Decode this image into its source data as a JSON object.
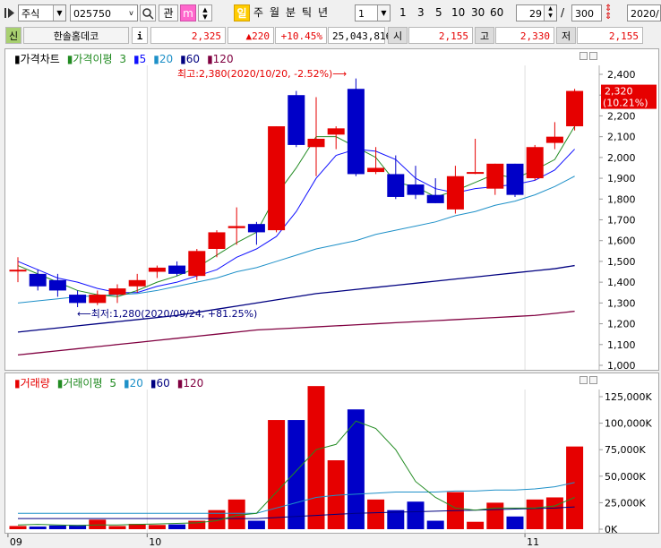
{
  "toolbar": {
    "market": "주식",
    "code": "025750",
    "fav_label": "관",
    "m_label": "m",
    "period_tabs": [
      "일",
      "주",
      "월",
      "분",
      "틱",
      "년"
    ],
    "interval_value": "1",
    "quick_intervals": [
      "1",
      "3",
      "5",
      "10",
      "30",
      "60"
    ],
    "count_value": "29",
    "slash": "/",
    "total_value": "300",
    "date_value": "2020/"
  },
  "info_bar": {
    "market_flag": "신",
    "name": "한솔홈데코",
    "info_button": "i",
    "price": "2,325",
    "change": "▲220",
    "change_pct": "+10.45%",
    "volume": "25,043,816",
    "open_label": "시",
    "open": "2,155",
    "high_label": "고",
    "high": "2,330",
    "low_label": "저",
    "low": "2,155"
  },
  "price_panel": {
    "legend": {
      "price": "가격차트",
      "ma_name": "가격이평",
      "ma3": "3",
      "ma5": "5",
      "ma20": "20",
      "ma60": "60",
      "ma120": "120"
    },
    "high_note": "최고:2,380(2020/10/20, -2.52%)⟶",
    "low_note": "⟵최저:1,280(2020/09/24, +81.25%)",
    "last_price": "2,320",
    "last_pct": "(10.21%)",
    "yticks": [
      "2,400",
      "2,300",
      "2,200",
      "2,100",
      "2,000",
      "1,900",
      "1,800",
      "1,700",
      "1,600",
      "1,500",
      "1,400",
      "1,300",
      "1,200",
      "1,100",
      "1,000"
    ]
  },
  "volume_panel": {
    "legend": {
      "vol": "거래량",
      "ma_name": "거래이평",
      "ma5": "5",
      "ma20": "20",
      "ma60": "60",
      "ma120": "120"
    },
    "yticks": [
      "125,000K",
      "100,000K",
      "75,000K",
      "50,000K",
      "25,000K",
      "0K"
    ]
  },
  "xticks": [
    "09",
    "10",
    "11"
  ],
  "colors": {
    "up": "#e60000",
    "down": "#0000c8",
    "ma3": "#228b22",
    "ma5": "#1010ff",
    "ma20": "#1e90c8",
    "ma60": "#000080",
    "ma120": "#800040"
  },
  "chart_data": {
    "type": "candlestick",
    "ylim": [
      1000,
      2400
    ],
    "vol_ylim": [
      0,
      125000
    ],
    "x_ticks": [
      {
        "label": "09",
        "index": 0
      },
      {
        "label": "10",
        "index": 7
      },
      {
        "label": "11",
        "index": 26
      }
    ],
    "candles": [
      {
        "o": 1460,
        "h": 1520,
        "l": 1400,
        "c": 1460,
        "v": 3000
      },
      {
        "o": 1440,
        "h": 1460,
        "l": 1360,
        "c": 1380,
        "v": 2500
      },
      {
        "o": 1410,
        "h": 1440,
        "l": 1330,
        "c": 1360,
        "v": 3500
      },
      {
        "o": 1340,
        "h": 1360,
        "l": 1280,
        "c": 1300,
        "v": 4000
      },
      {
        "o": 1300,
        "h": 1360,
        "l": 1290,
        "c": 1340,
        "v": 9000
      },
      {
        "o": 1340,
        "h": 1390,
        "l": 1300,
        "c": 1370,
        "v": 3000
      },
      {
        "o": 1380,
        "h": 1440,
        "l": 1350,
        "c": 1410,
        "v": 5000
      },
      {
        "o": 1450,
        "h": 1480,
        "l": 1420,
        "c": 1470,
        "v": 4000
      },
      {
        "o": 1480,
        "h": 1500,
        "l": 1430,
        "c": 1440,
        "v": 4500
      },
      {
        "o": 1430,
        "h": 1560,
        "l": 1410,
        "c": 1550,
        "v": 8000
      },
      {
        "o": 1560,
        "h": 1650,
        "l": 1520,
        "c": 1640,
        "v": 18000
      },
      {
        "o": 1660,
        "h": 1760,
        "l": 1580,
        "c": 1670,
        "v": 28000
      },
      {
        "o": 1680,
        "h": 1690,
        "l": 1580,
        "c": 1640,
        "v": 8000
      },
      {
        "o": 1650,
        "h": 2150,
        "l": 1640,
        "c": 2150,
        "v": 103000
      },
      {
        "o": 2300,
        "h": 2320,
        "l": 2050,
        "c": 2060,
        "v": 103000
      },
      {
        "o": 2050,
        "h": 2290,
        "l": 1910,
        "c": 2090,
        "v": 135000
      },
      {
        "o": 2110,
        "h": 2150,
        "l": 2040,
        "c": 2140,
        "v": 65000
      },
      {
        "o": 2330,
        "h": 2380,
        "l": 1910,
        "c": 1920,
        "v": 113000
      },
      {
        "o": 1930,
        "h": 2050,
        "l": 1920,
        "c": 1950,
        "v": 28000
      },
      {
        "o": 1920,
        "h": 2010,
        "l": 1800,
        "c": 1810,
        "v": 18000
      },
      {
        "o": 1870,
        "h": 1960,
        "l": 1800,
        "c": 1820,
        "v": 26000
      },
      {
        "o": 1820,
        "h": 1900,
        "l": 1780,
        "c": 1780,
        "v": 8000
      },
      {
        "o": 1750,
        "h": 1960,
        "l": 1730,
        "c": 1910,
        "v": 35000
      },
      {
        "o": 1930,
        "h": 2090,
        "l": 1920,
        "c": 1930,
        "v": 7000
      },
      {
        "o": 1850,
        "h": 1970,
        "l": 1820,
        "c": 1970,
        "v": 25000
      },
      {
        "o": 1970,
        "h": 1970,
        "l": 1810,
        "c": 1820,
        "v": 12000
      },
      {
        "o": 1900,
        "h": 2060,
        "l": 1890,
        "c": 2050,
        "v": 28000
      },
      {
        "o": 2070,
        "h": 2170,
        "l": 2040,
        "c": 2100,
        "v": 30000
      },
      {
        "o": 2150,
        "h": 2330,
        "l": 2130,
        "c": 2320,
        "v": 78000
      }
    ],
    "ma3": [
      1480,
      1440,
      1400,
      1360,
      1340,
      1330,
      1360,
      1400,
      1430,
      1470,
      1530,
      1590,
      1640,
      1820,
      1950,
      2100,
      2100,
      2050,
      2000,
      1880,
      1860,
      1810,
      1840,
      1880,
      1920,
      1900,
      1940,
      1990,
      2150
    ],
    "ma5": [
      1500,
      1460,
      1420,
      1400,
      1370,
      1350,
      1350,
      1380,
      1400,
      1430,
      1460,
      1520,
      1560,
      1620,
      1740,
      1900,
      2010,
      2040,
      2030,
      1990,
      1900,
      1850,
      1830,
      1850,
      1860,
      1870,
      1890,
      1940,
      2040
    ],
    "ma20": [
      1300,
      1310,
      1320,
      1330,
      1335,
      1340,
      1345,
      1360,
      1380,
      1400,
      1420,
      1450,
      1470,
      1500,
      1530,
      1560,
      1580,
      1600,
      1630,
      1650,
      1670,
      1690,
      1720,
      1740,
      1770,
      1790,
      1820,
      1860,
      1910
    ],
    "ma60": [
      1160,
      1170,
      1180,
      1190,
      1200,
      1210,
      1220,
      1230,
      1240,
      1255,
      1270,
      1285,
      1300,
      1315,
      1330,
      1345,
      1355,
      1365,
      1375,
      1385,
      1395,
      1405,
      1415,
      1425,
      1435,
      1445,
      1455,
      1465,
      1480
    ],
    "ma120": [
      1050,
      1060,
      1070,
      1080,
      1090,
      1100,
      1110,
      1120,
      1130,
      1140,
      1150,
      1160,
      1170,
      1175,
      1180,
      1185,
      1190,
      1195,
      1200,
      1205,
      1210,
      1215,
      1220,
      1225,
      1230,
      1235,
      1240,
      1250,
      1260
    ],
    "vma5": [
      4000,
      4500,
      4000,
      3500,
      4000,
      4000,
      4500,
      5000,
      5500,
      6000,
      8000,
      13000,
      15000,
      35000,
      55000,
      75000,
      80000,
      102000,
      95000,
      75000,
      45000,
      30000,
      20000,
      18000,
      20000,
      20000,
      20000,
      22000,
      30000
    ],
    "vma20": [
      15000,
      15000,
      15000,
      15000,
      15000,
      15000,
      15000,
      15000,
      15000,
      15000,
      15000,
      15000,
      15000,
      20000,
      25000,
      30000,
      32000,
      33000,
      34000,
      35000,
      35000,
      35000,
      36000,
      36000,
      37000,
      37000,
      38000,
      40000,
      44000
    ],
    "vma60": [
      10000,
      10000,
      10000,
      10000,
      10000,
      10000,
      10000,
      10000,
      10000,
      10000,
      10000,
      10000,
      10000,
      11000,
      12000,
      13000,
      14000,
      15000,
      15500,
      16000,
      16500,
      17000,
      17500,
      18000,
      18500,
      19000,
      19500,
      20000,
      21000
    ]
  }
}
